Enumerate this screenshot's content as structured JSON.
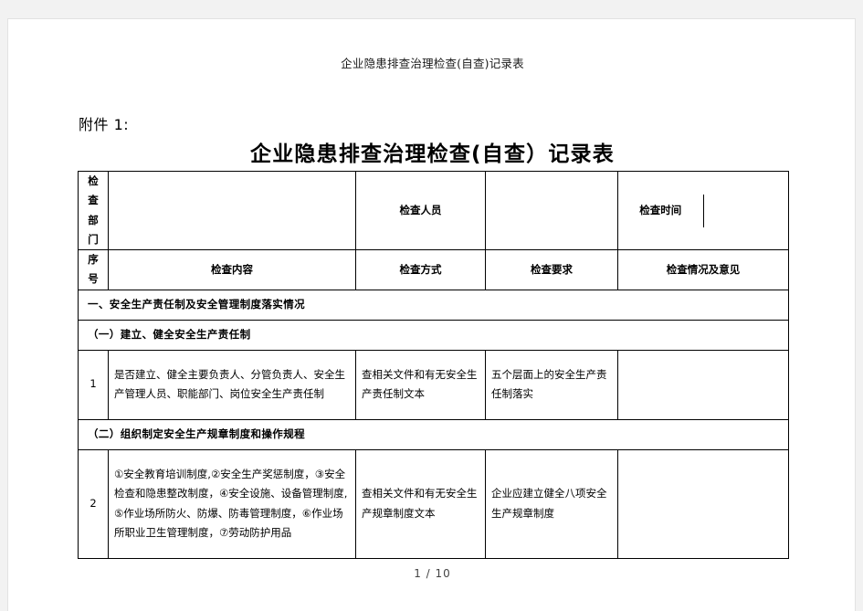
{
  "document": {
    "running_head": "企业隐患排查治理检查(自查)记录表",
    "attachment_label": "附件 1:",
    "title": "企业隐患排查治理检查(自查）记录表",
    "footer": "1  /  10"
  },
  "meta_row": {
    "department_label": "检查部门",
    "department_value": "",
    "inspector_label": "检查人员",
    "inspector_value": "",
    "time_label": "检查时间",
    "time_value": ""
  },
  "columns": {
    "num": "序号",
    "item": "检查内容",
    "method": "检查方式",
    "requirement": "检查要求",
    "result": "检查情况及意见"
  },
  "sections": {
    "s1": "一、安全生产责任制及安全管理制度落实情况",
    "s1_1": "（一）建立、健全安全生产责任制",
    "s1_2": "（二）组织制定安全生产规章制度和操作规程"
  },
  "rows": [
    {
      "num": "1",
      "item": "是否建立、健全主要负责人、分管负责人、安全生产管理人员、职能部门、岗位安全生产责任制",
      "method": "查相关文件和有无安全生产责任制文本",
      "requirement": "五个层面上的安全生产责任制落实",
      "result": ""
    },
    {
      "num": "2",
      "item": "①安全教育培训制度,②安全生产奖惩制度，③安全检查和隐患整改制度，④安全设施、设备管理制度,⑤作业场所防火、防爆、防毒管理制度，⑥作业场所职业卫生管理制度，⑦劳动防护用品",
      "method": "查相关文件和有无安全生产规章制度文本",
      "requirement": "企业应建立健全八项安全生产规章制度",
      "result": ""
    }
  ]
}
